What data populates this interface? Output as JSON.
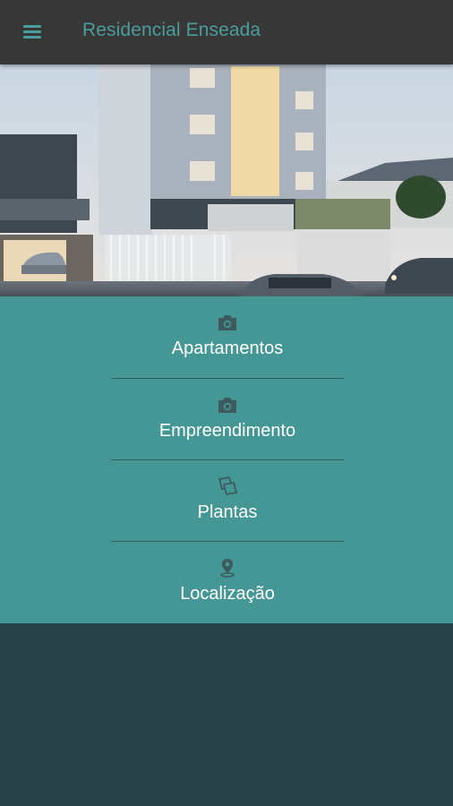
{
  "header": {
    "title": "Residencial Enseada",
    "menu_icon": "hamburger-menu-icon"
  },
  "hero": {
    "image": "building-render-photo"
  },
  "menu": {
    "items": [
      {
        "label": "Apartamentos",
        "icon": "camera-icon"
      },
      {
        "label": "Empreendimento",
        "icon": "camera-icon"
      },
      {
        "label": "Plantas",
        "icon": "floorplan-icon"
      },
      {
        "label": "Localização",
        "icon": "map-pin-icon"
      }
    ]
  },
  "colors": {
    "topbar": "#373737",
    "accent": "#4a9d9a",
    "menu_bg": "#449795",
    "bottom_bg": "#264247",
    "icon": "#3d5b5c"
  }
}
